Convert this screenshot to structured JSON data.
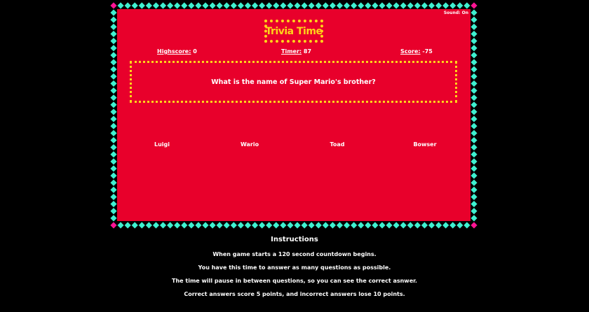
{
  "game": {
    "title": "Trivia Time",
    "sound_label": "Sound: On",
    "stats": {
      "highscore_label": "Highscore:",
      "highscore_value": "0",
      "timer_label": "Timer:",
      "timer_value": "87",
      "score_label": "Score:",
      "score_value": "-75"
    },
    "question": "What is the name of Super Mario's brother?",
    "answers": [
      "Luigi",
      "Wario",
      "Toad",
      "Bowser"
    ]
  },
  "instructions": {
    "heading": "Instructions",
    "lines": [
      "When game starts a 120 second countdown begins.",
      "You have this time to answer as many questions as possible.",
      "The time will pause in between questions, so you can see the correct asnwer.",
      "Correct answers score 5 points, and incorrect answers lose 10 points."
    ]
  },
  "colors": {
    "background": "#000000",
    "board": "#e8002b",
    "accent_yellow": "#ffd21a",
    "diamond_cyan": "#3ef0d0",
    "diamond_pink": "#ff1493"
  }
}
